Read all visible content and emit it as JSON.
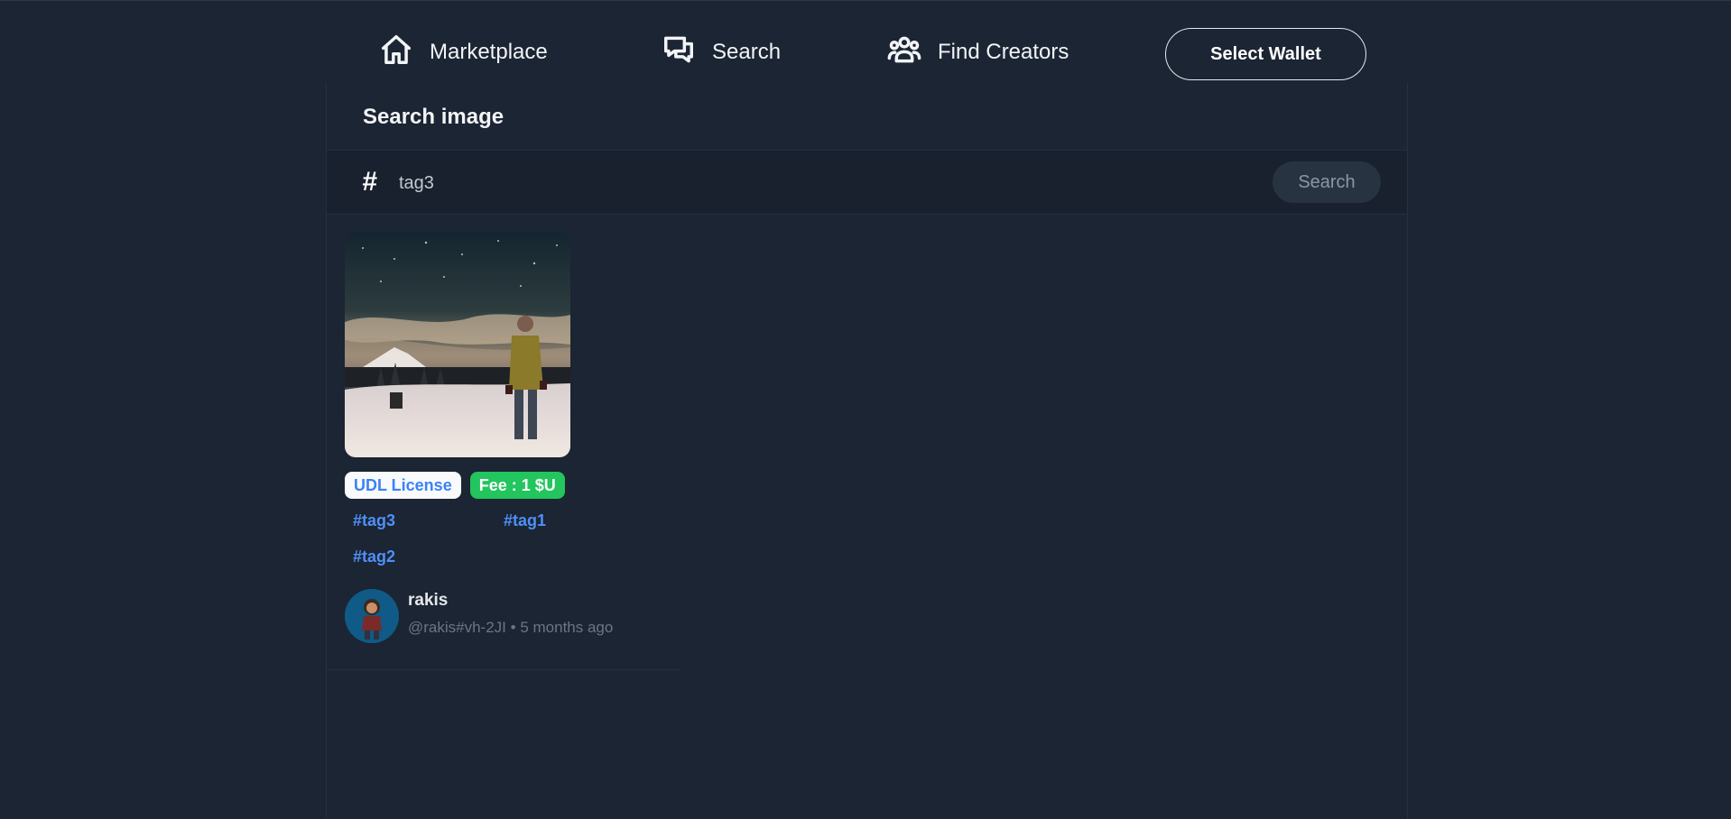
{
  "nav": {
    "marketplace": {
      "label": "Marketplace",
      "icon": "home-icon"
    },
    "search": {
      "label": "Search",
      "icon": "chat-bubbles-icon"
    },
    "creators": {
      "label": "Find Creators",
      "icon": "users-icon"
    },
    "wallet_button": "Select Wallet"
  },
  "main": {
    "title": "Search image",
    "search": {
      "hash_symbol": "#",
      "value": "tag3",
      "button": "Search"
    },
    "results": [
      {
        "license": "UDL License",
        "fee": "Fee : 1 $U",
        "tags": [
          "#tag3",
          "#tag1",
          "#tag2"
        ],
        "author": {
          "name": "rakis",
          "handle": "@rakis#vh-2JI",
          "separator": "•",
          "time": "5 months ago"
        }
      }
    ]
  },
  "colors": {
    "background": "#1b2533",
    "search_bar": "#18212d",
    "license_text": "#3b82f6",
    "fee_badge": "#22c55e",
    "tag": "#4f8ff7"
  }
}
